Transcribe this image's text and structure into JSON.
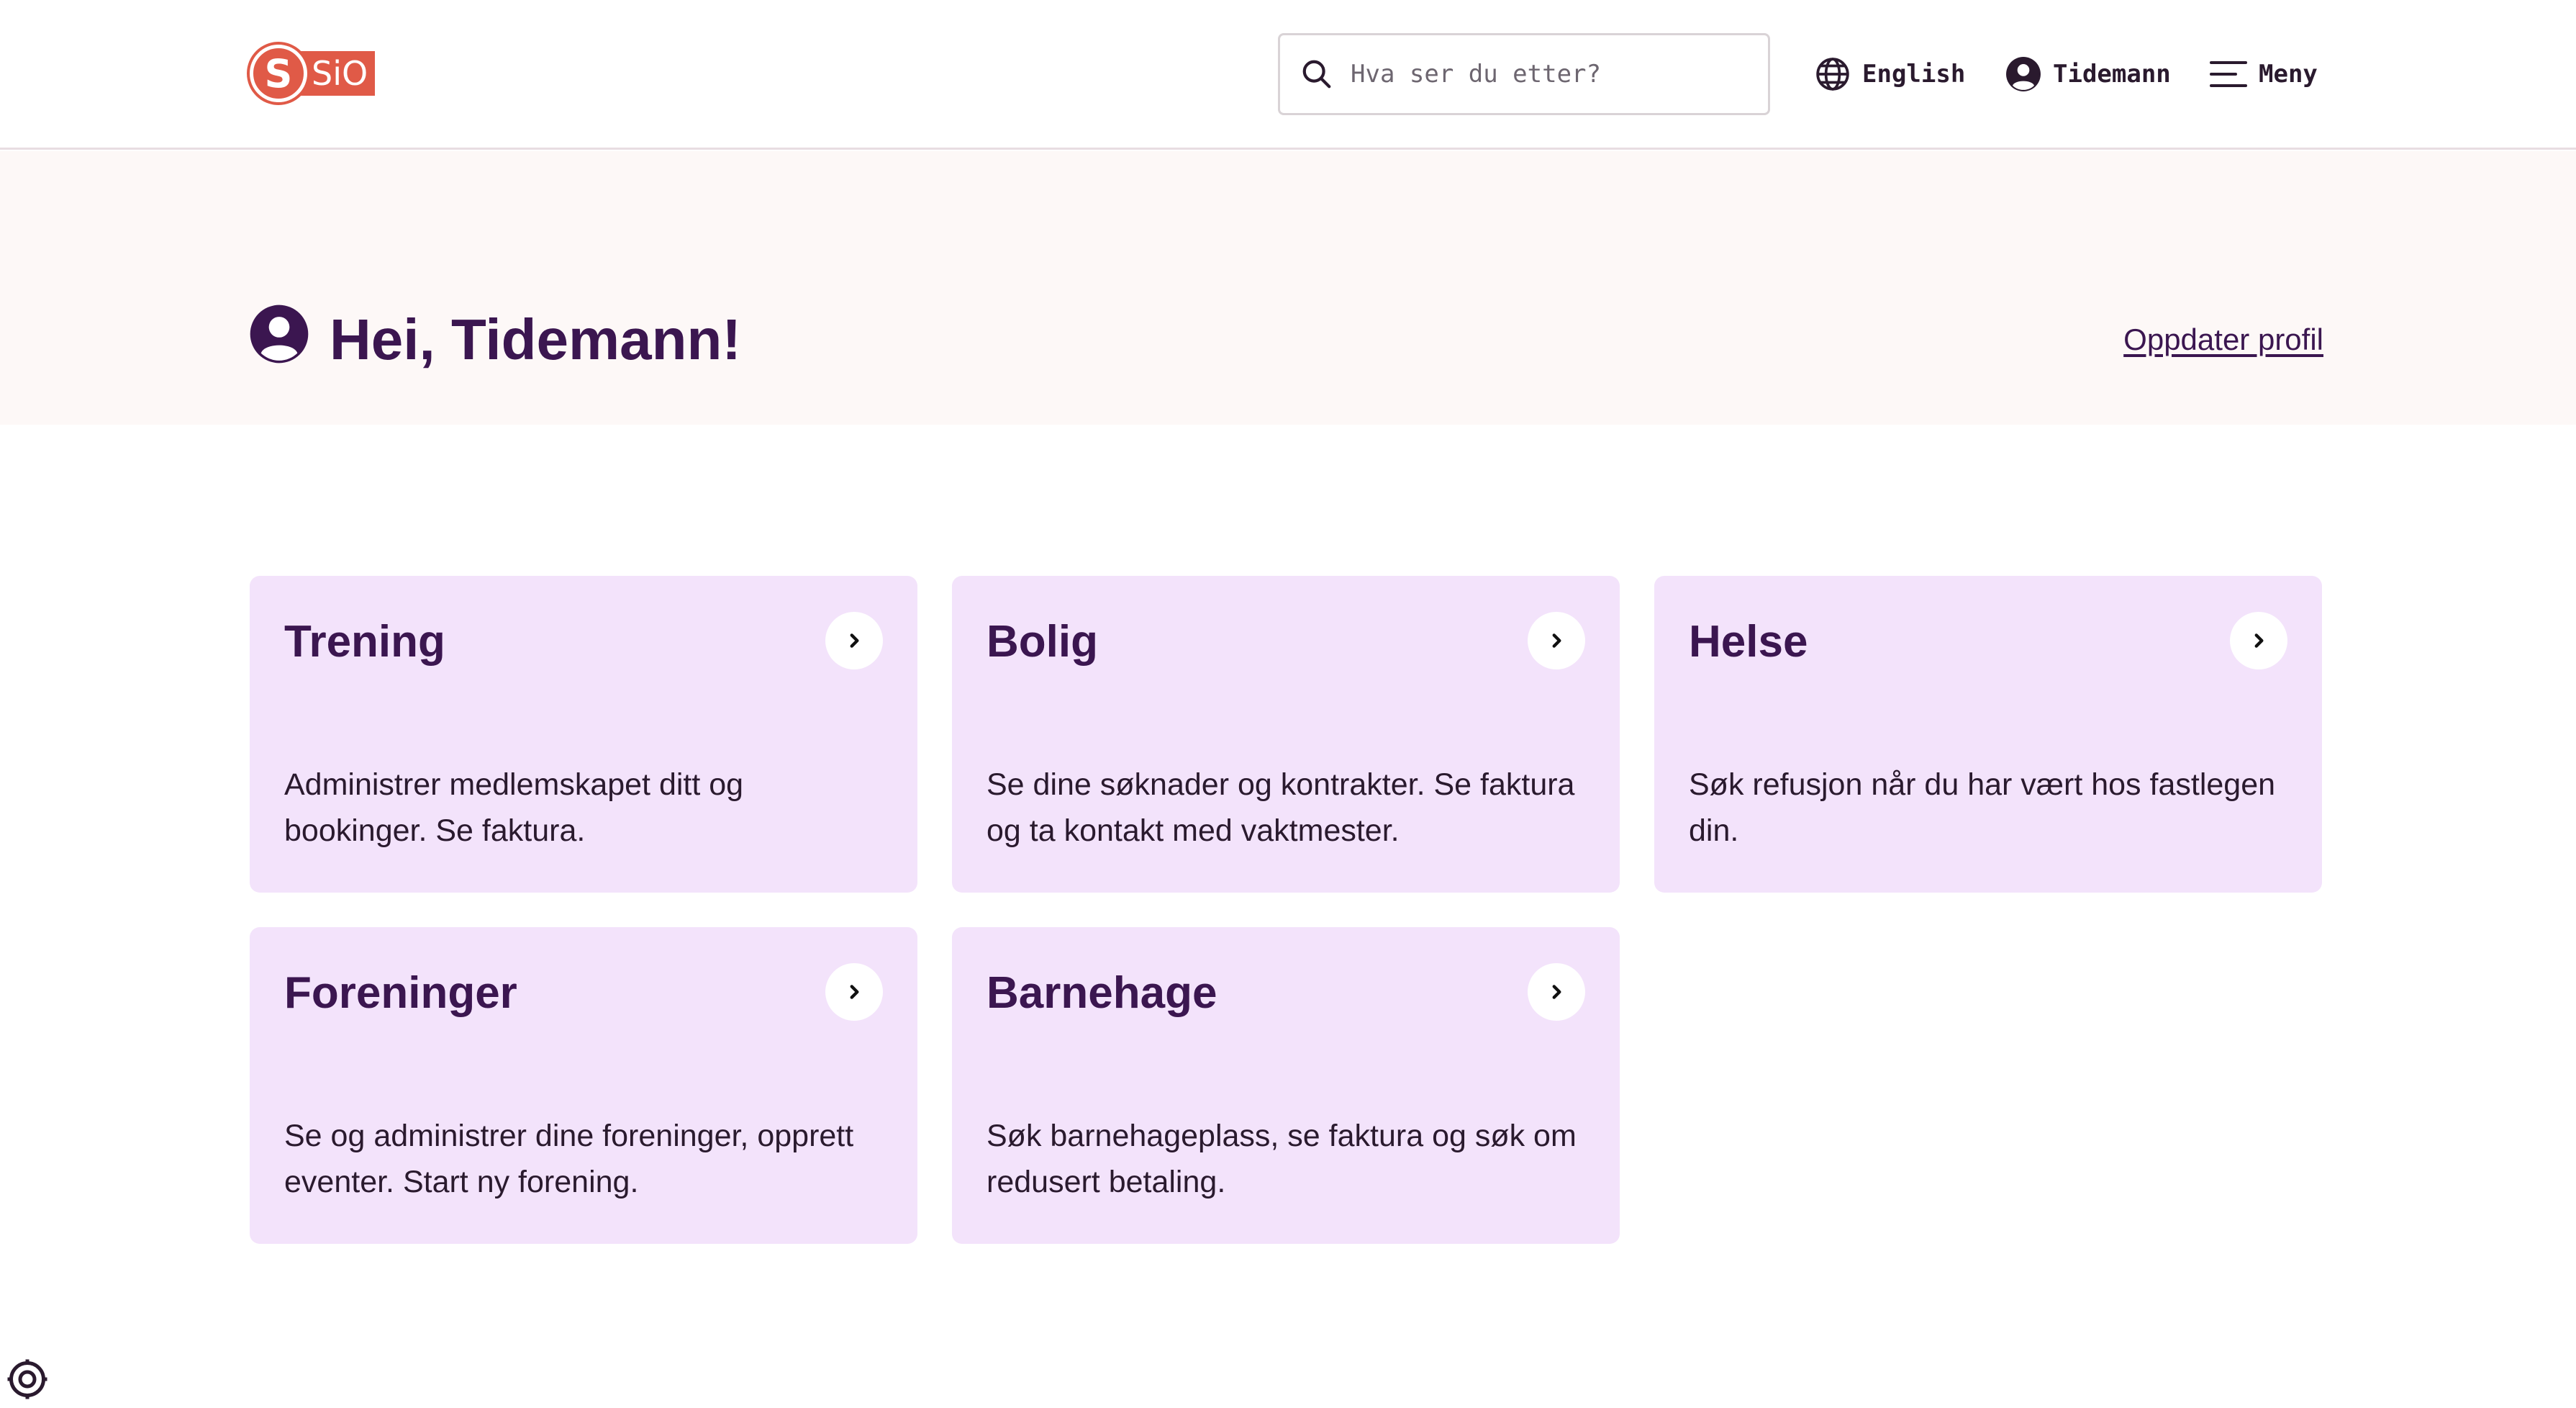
{
  "header": {
    "logo_text": "SiO",
    "logo_mark": "S",
    "search_placeholder": "Hva ser du etter?",
    "language_label": "English",
    "user_label": "Tidemann",
    "menu_label": "Meny"
  },
  "hero": {
    "greeting": "Hei, Tidemann!",
    "update_profile": "Oppdater profil"
  },
  "cards": [
    {
      "title": "Trening",
      "description": "Administrer medlemskapet ditt og bookinger. Se faktura."
    },
    {
      "title": "Bolig",
      "description": "Se dine søknader og kontrakter. Se faktura og ta kontakt med vaktmester."
    },
    {
      "title": "Helse",
      "description": "Søk refusjon når du har vært hos fastlegen din."
    },
    {
      "title": "Foreninger",
      "description": "Se og administrer dine foreninger, opprett eventer. Start ny forening."
    },
    {
      "title": "Barnehage",
      "description": "Søk barnehageplass, se faktura og søk om redusert betaling."
    }
  ],
  "colors": {
    "brand": "#e05a47",
    "primary_text": "#3b1650",
    "card_bg": "#f3e3fb",
    "hero_bg": "#fdf8f7"
  },
  "icons": [
    "search-icon",
    "globe-icon",
    "user-icon",
    "hamburger-menu-icon",
    "chevron-right-icon",
    "accessibility-icon"
  ]
}
